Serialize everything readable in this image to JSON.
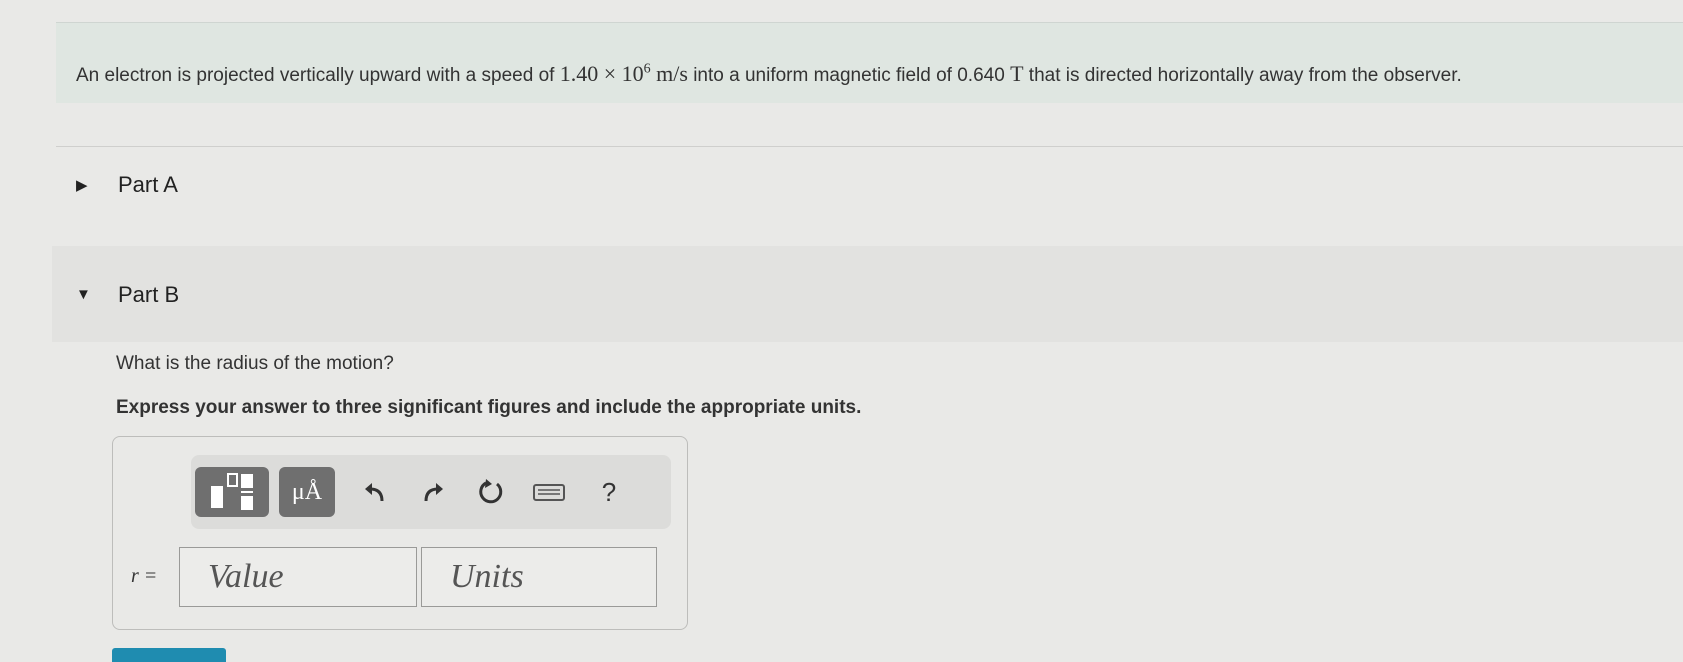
{
  "problem": {
    "text_before": "An electron is projected vertically upward with a speed of ",
    "speed_mantissa": "1.40 × 10",
    "speed_exponent": "6",
    "speed_unit": " m/s",
    "text_middle": " into a uniform magnetic field of 0.640 ",
    "field_unit": "T",
    "text_after": " that is directed horizontally away from the observer."
  },
  "parts": [
    {
      "label": "Part A",
      "expanded": false
    },
    {
      "label": "Part B",
      "expanded": true
    }
  ],
  "partB": {
    "question": "What is the radius of the motion?",
    "instruction": "Express your answer to three significant figures and include the appropriate units.",
    "variable": "r =",
    "value_placeholder": "Value",
    "units_placeholder": "Units"
  },
  "toolbar": {
    "templates_icon": "fraction-template-icon",
    "units_label": "μÅ",
    "undo_icon": "undo-icon",
    "redo_icon": "redo-icon",
    "reset_icon": "reset-icon",
    "keyboard_icon": "keyboard-icon",
    "help_label": "?"
  },
  "colors": {
    "problem_bg": "#dfe6e1",
    "partB_bg": "#e2e2e0",
    "toolbar_bg": "#dcdcda",
    "gray_button": "#6f6f6f",
    "submit_button": "#1f8cb0"
  }
}
